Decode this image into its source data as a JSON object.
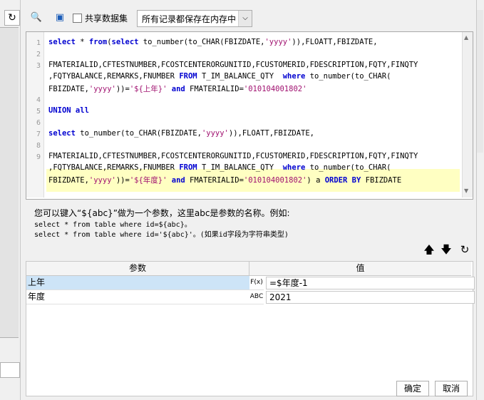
{
  "toolbar": {
    "share_label": "共享数据集",
    "cache_value": "所有记录都保存在内存中"
  },
  "editor": {
    "line_numbers": [
      "1",
      "2",
      "3",
      "4",
      "5",
      "6",
      "7",
      "8",
      "9"
    ]
  },
  "hint": {
    "line1": "您可以键入“${abc}”做为一个参数，这里abc是参数的名称。例如:",
    "line2": "select * from table where id=${abc}。",
    "line3": "select * from table where id='${abc}'。(如果id字段为字符串类型)"
  },
  "params": {
    "header_param": "参数",
    "header_value": "值",
    "rows": [
      {
        "name": "上年",
        "type_icon": "F(x)",
        "value": "=$年度-1"
      },
      {
        "name": "年度",
        "type_icon": "ABC",
        "value": "2021"
      }
    ]
  },
  "footer": {
    "ok_label": "确定",
    "cancel_label": "取消"
  },
  "icons": {
    "left_refresh": "refresh-icon",
    "print": "print-preview-icon",
    "save": "save-icon",
    "up": "arrow-up-icon",
    "down": "arrow-down-icon",
    "reset": "refresh-icon"
  }
}
